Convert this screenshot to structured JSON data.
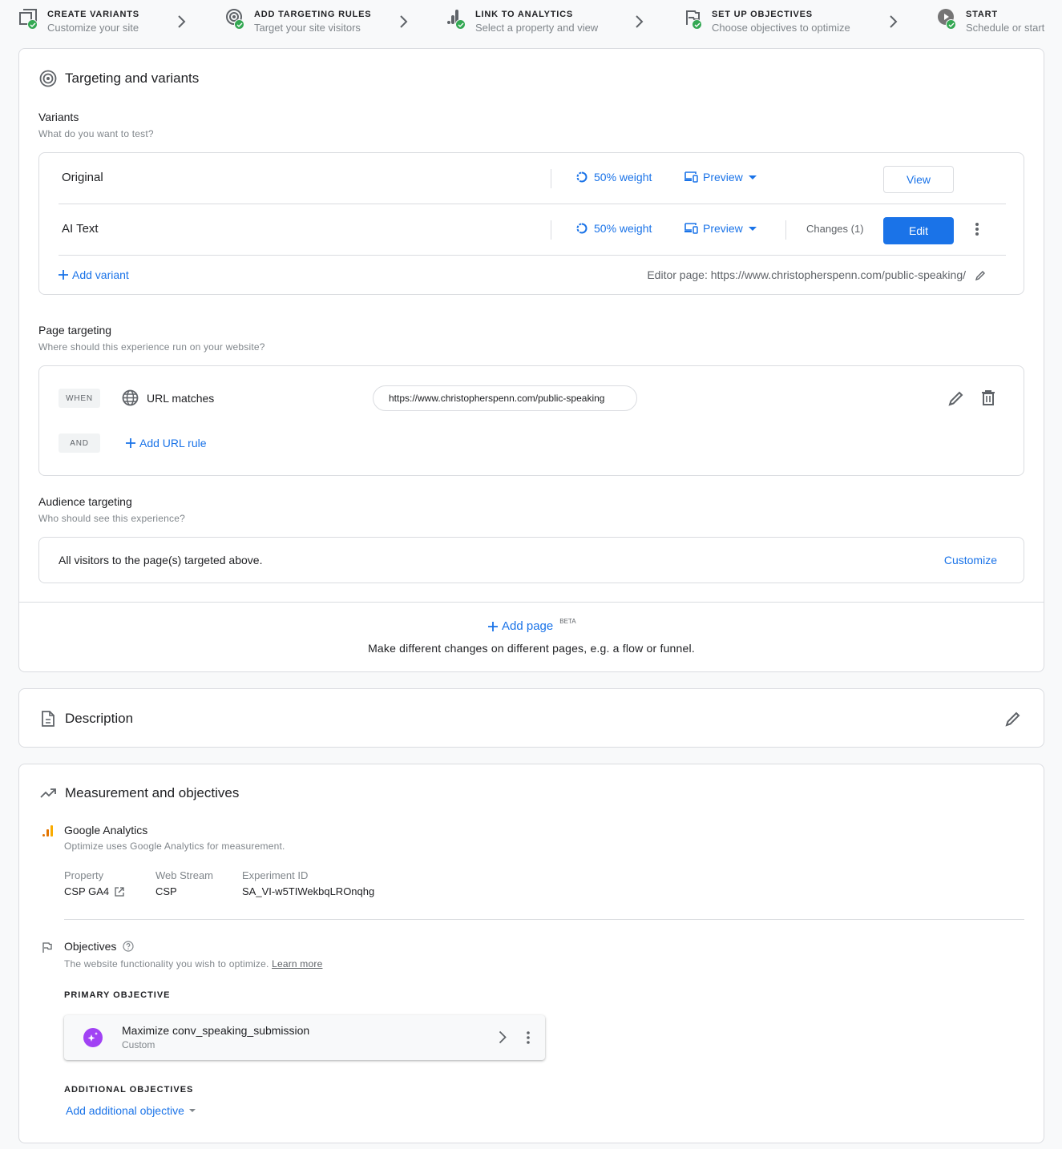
{
  "stepper": {
    "steps": [
      {
        "title": "CREATE VARIANTS",
        "subtitle": "Customize your site",
        "icon": "variants-icon",
        "status": "complete"
      },
      {
        "title": "ADD TARGETING RULES",
        "subtitle": "Target your site visitors",
        "icon": "target-icon",
        "status": "complete"
      },
      {
        "title": "LINK TO ANALYTICS",
        "subtitle": "Select a property and view",
        "icon": "analytics-icon",
        "status": "complete"
      },
      {
        "title": "SET UP OBJECTIVES",
        "subtitle": "Choose objectives to optimize",
        "icon": "flag-icon",
        "status": "complete"
      },
      {
        "title": "START",
        "subtitle": "Schedule or start",
        "icon": "play-icon",
        "status": "complete"
      }
    ]
  },
  "targeting": {
    "title": "Targeting and variants",
    "variants": {
      "title": "Variants",
      "subtitle": "What do you want to test?",
      "rows": [
        {
          "name": "Original",
          "weight": "50% weight",
          "preview": "Preview",
          "action": "View"
        },
        {
          "name": "AI Text",
          "weight": "50% weight",
          "preview": "Preview",
          "changes": "Changes (1)",
          "action": "Edit"
        }
      ],
      "add_variant": "Add variant",
      "editor_page": "Editor page: https://www.christopherspenn.com/public-speaking/"
    },
    "page_targeting": {
      "title": "Page targeting",
      "subtitle": "Where should this experience run on your website?",
      "when_chip": "WHEN",
      "rule_type": "URL matches",
      "url_value": "https://www.christopherspenn.com/public-speaking",
      "and_chip": "AND",
      "add_url_rule": "Add URL rule"
    },
    "audience": {
      "title": "Audience targeting",
      "subtitle": "Who should see this experience?",
      "summary": "All visitors to the page(s) targeted above.",
      "customize": "Customize"
    },
    "add_page": {
      "label": "Add page",
      "badge": "BETA",
      "description": "Make different changes on different pages, e.g. a flow or funnel."
    }
  },
  "description": {
    "title": "Description"
  },
  "measurement": {
    "title": "Measurement and objectives",
    "analytics": {
      "title": "Google Analytics",
      "subtitle": "Optimize uses Google Analytics for measurement.",
      "property_label": "Property",
      "property_value": "CSP GA4",
      "stream_label": "Web Stream",
      "stream_value": "CSP",
      "experiment_label": "Experiment ID",
      "experiment_value": "SA_VI-w5TIWekbqLROnqhg"
    },
    "objectives": {
      "title": "Objectives",
      "subtitle": "The website functionality you wish to optimize.",
      "learn_more": "Learn more",
      "primary_label": "PRIMARY OBJECTIVE",
      "primary_name": "Maximize conv_speaking_submission",
      "primary_type": "Custom",
      "additional_label": "ADDITIONAL OBJECTIVES",
      "add_additional": "Add additional objective"
    }
  },
  "colors": {
    "accent": "#1a73e8",
    "success": "#34a853",
    "objective_icon": "#a142f4",
    "analytics_orange": "#f9ab00"
  }
}
